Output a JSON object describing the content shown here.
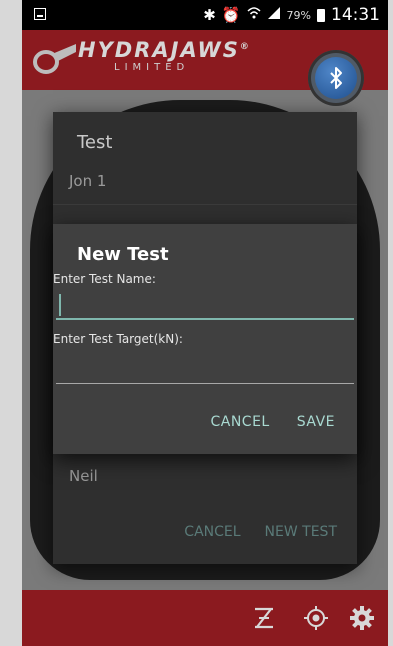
{
  "status_bar": {
    "battery_percent": "79%",
    "time": "14:31"
  },
  "header": {
    "brand": "HYDRAJAWS",
    "brand_reg": "®",
    "brand_sub": "LIMITED"
  },
  "background_dialog": {
    "title": "Test",
    "items": [
      "Jon 1",
      "Neil"
    ],
    "cancel_label": "CANCEL",
    "new_test_label": "NEW TEST"
  },
  "dialog": {
    "title": "New Test",
    "name_label": "Enter Test Name:",
    "name_value": "",
    "target_label": "Enter Test Target(kN):",
    "target_value": "",
    "cancel_label": "CANCEL",
    "save_label": "SAVE"
  },
  "colors": {
    "brand_red": "#8b1a1f",
    "accent_teal": "#7fb7ad",
    "dialog_bg": "#404040"
  }
}
